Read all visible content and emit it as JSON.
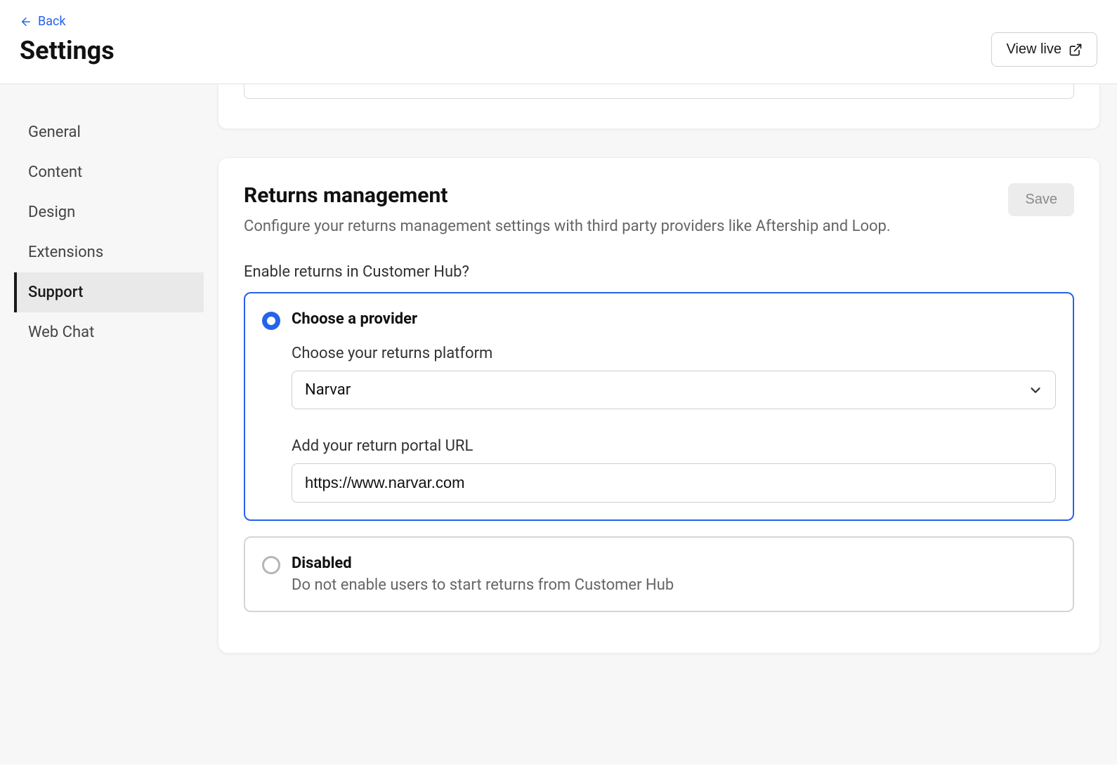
{
  "header": {
    "back_label": "Back",
    "title": "Settings",
    "view_live_label": "View live"
  },
  "sidebar": {
    "items": [
      {
        "label": "General",
        "active": false
      },
      {
        "label": "Content",
        "active": false
      },
      {
        "label": "Design",
        "active": false
      },
      {
        "label": "Extensions",
        "active": false
      },
      {
        "label": "Support",
        "active": true
      },
      {
        "label": "Web Chat",
        "active": false
      }
    ]
  },
  "returns": {
    "title": "Returns management",
    "subtitle": "Configure your returns management settings with third party providers like Aftership and Loop.",
    "save_label": "Save",
    "question": "Enable returns in Customer Hub?",
    "option_provider": {
      "title": "Choose a provider",
      "platform_label": "Choose your returns platform",
      "platform_value": "Narvar",
      "url_label": "Add your return portal URL",
      "url_value": "https://www.narvar.com"
    },
    "option_disabled": {
      "title": "Disabled",
      "desc": "Do not enable users to start returns from Customer Hub"
    }
  }
}
